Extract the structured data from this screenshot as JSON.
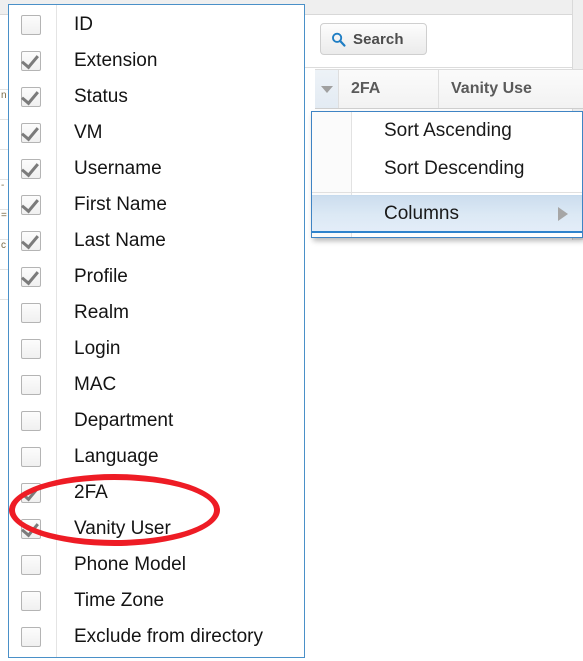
{
  "app": {
    "background_rows": [
      "",
      "n",
      "",
      "",
      "-",
      "=",
      "c",
      ""
    ]
  },
  "toolbar": {
    "search_label": "Search",
    "search_icon": "magnifier-icon"
  },
  "grid_header": {
    "sorter_icon": "chevron-down-icon",
    "columns": [
      "2FA",
      "Vanity Use"
    ]
  },
  "context_menu": {
    "items": [
      {
        "label": "Sort Ascending",
        "highlighted": false,
        "submenu": false
      },
      {
        "label": "Sort Descending",
        "highlighted": false,
        "submenu": false
      },
      {
        "label": "Columns",
        "highlighted": true,
        "submenu": true
      }
    ],
    "submenu_arrow_icon": "caret-right-icon"
  },
  "columns_panel": {
    "items": [
      {
        "label": "ID",
        "checked": false
      },
      {
        "label": "Extension",
        "checked": true
      },
      {
        "label": "Status",
        "checked": true
      },
      {
        "label": "VM",
        "checked": true
      },
      {
        "label": "Username",
        "checked": true
      },
      {
        "label": "First Name",
        "checked": true
      },
      {
        "label": "Last Name",
        "checked": true
      },
      {
        "label": "Profile",
        "checked": true
      },
      {
        "label": "Realm",
        "checked": false
      },
      {
        "label": "Login",
        "checked": false
      },
      {
        "label": "MAC",
        "checked": false
      },
      {
        "label": "Department",
        "checked": false
      },
      {
        "label": "Language",
        "checked": false
      },
      {
        "label": "2FA",
        "checked": true
      },
      {
        "label": "Vanity User",
        "checked": true
      },
      {
        "label": "Phone Model",
        "checked": false
      },
      {
        "label": "Time Zone",
        "checked": false
      },
      {
        "label": "Exclude from directory",
        "checked": false
      }
    ]
  },
  "annotation": {
    "shape": "oval",
    "color": "#ee1c25",
    "targets": [
      "2FA",
      "Vanity User"
    ]
  }
}
